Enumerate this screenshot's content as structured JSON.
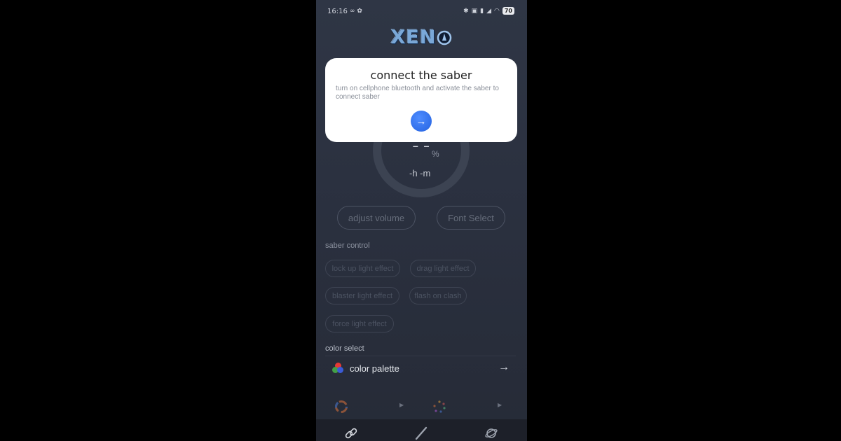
{
  "status_bar": {
    "time": "16:16",
    "left_icons": "∞ ✿",
    "battery": "70"
  },
  "logo": {
    "text": "XEN"
  },
  "dialog": {
    "title": "connect the saber",
    "message": "turn on cellphone bluetooth and activate the saber to connect saber",
    "next_icon": "arrow-right-icon"
  },
  "gauge": {
    "value": "– –",
    "unit": "%",
    "time": "-h -m"
  },
  "buttons": {
    "adjust_volume": "adjust volume",
    "font_select": "Font Select"
  },
  "saber_control": {
    "label": "saber control",
    "effects": [
      "lock up light effect",
      "drag light effect",
      "blaster light effect",
      "flash on clash",
      "force light effect"
    ]
  },
  "color_select": {
    "label": "color select",
    "palette_label": "color palette"
  },
  "colors": {
    "accent": "#2f6df0",
    "background": "#2b3140",
    "dialog": "#ffffff"
  }
}
